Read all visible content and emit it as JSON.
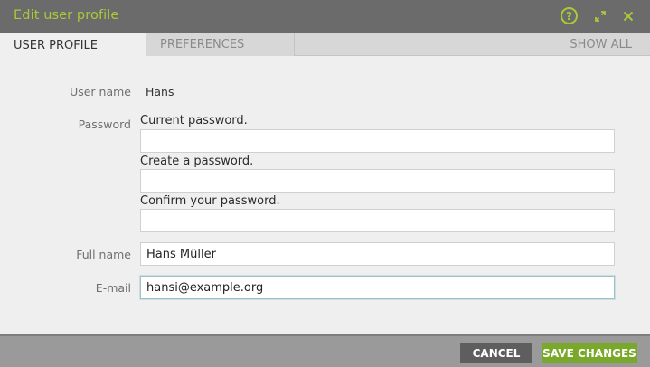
{
  "window": {
    "title": "Edit user profile",
    "help_icon_glyph": "?",
    "icons": [
      "help-icon",
      "expand-icon",
      "close-icon"
    ]
  },
  "tabs": [
    {
      "label": "User profile",
      "active": true
    },
    {
      "label": "Preferences",
      "active": false
    }
  ],
  "show_all_label": "Show all",
  "form": {
    "username_label": "User name",
    "username_value": "Hans",
    "password_label": "Password",
    "current_password_hint": "Current password.",
    "current_password_value": "",
    "create_password_hint": "Create a password.",
    "create_password_value": "",
    "confirm_password_hint": "Confirm your password.",
    "confirm_password_value": "",
    "fullname_label": "Full name",
    "fullname_value": "Hans Müller",
    "email_label": "E-mail",
    "email_value": "hansi@example.org"
  },
  "footer": {
    "cancel_label": "Cancel",
    "save_label": "Save changes"
  },
  "colors": {
    "accent": "#a8c93a",
    "save_button": "#79a82a",
    "cancel_button": "#5e5e5e",
    "titlebar": "#6b6b6b"
  }
}
